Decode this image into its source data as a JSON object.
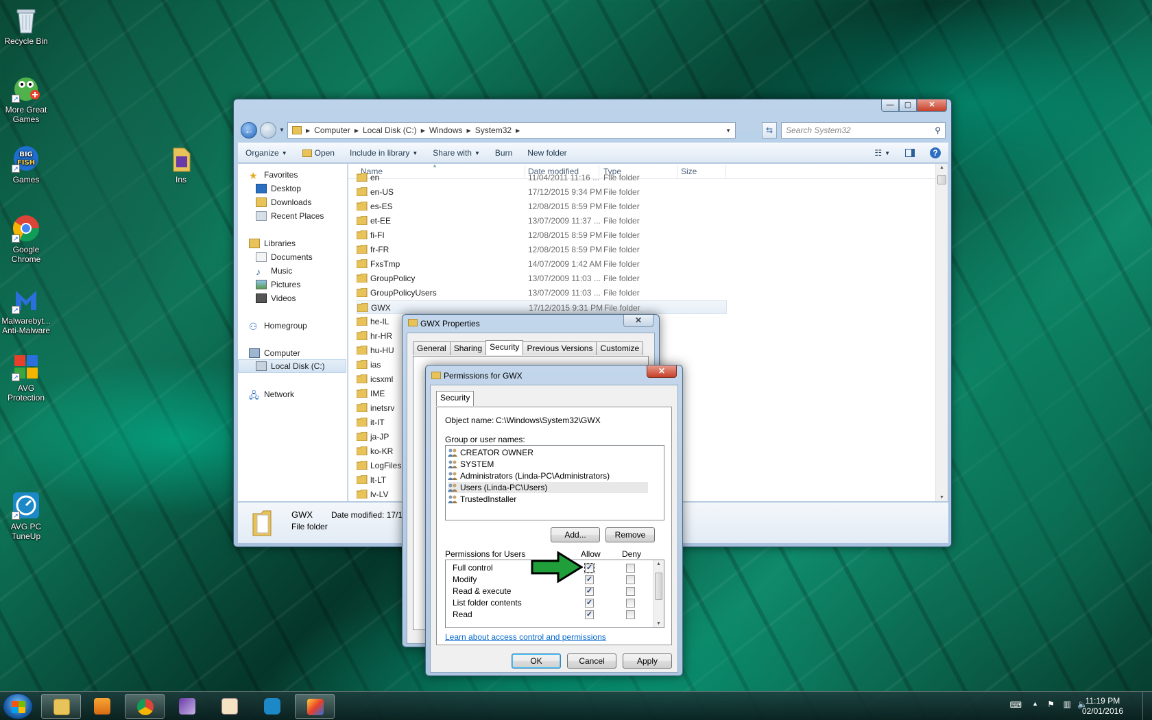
{
  "desktop": {
    "icons": [
      {
        "label": "Recycle Bin"
      },
      {
        "label": "More Great Games"
      },
      {
        "label": "Games"
      },
      {
        "label": "Google Chrome"
      },
      {
        "label": "Malwarebyt... Anti-Malware"
      },
      {
        "label": "AVG Protection"
      },
      {
        "label": "AVG PC TuneUp"
      },
      {
        "label": "Ins"
      }
    ]
  },
  "explorer": {
    "breadcrumb": [
      "Computer",
      "Local Disk (C:)",
      "Windows",
      "System32"
    ],
    "search_placeholder": "Search System32",
    "toolbar": {
      "organize": "Organize",
      "open": "Open",
      "include": "Include in library",
      "share": "Share with",
      "burn": "Burn",
      "new_folder": "New folder"
    },
    "nav": {
      "favorites": "Favorites",
      "desktop": "Desktop",
      "downloads": "Downloads",
      "recent": "Recent Places",
      "libraries": "Libraries",
      "documents": "Documents",
      "music": "Music",
      "pictures": "Pictures",
      "videos": "Videos",
      "homegroup": "Homegroup",
      "computer": "Computer",
      "local_disk": "Local Disk (C:)",
      "network": "Network"
    },
    "columns": {
      "name": "Name",
      "date": "Date modified",
      "type": "Type",
      "size": "Size"
    },
    "rows": [
      {
        "name": "en",
        "date": "11/04/2011 11:16 ...",
        "type": "File folder"
      },
      {
        "name": "en-US",
        "date": "17/12/2015 9:34 PM",
        "type": "File folder"
      },
      {
        "name": "es-ES",
        "date": "12/08/2015 8:59 PM",
        "type": "File folder"
      },
      {
        "name": "et-EE",
        "date": "13/07/2009 11:37 ...",
        "type": "File folder"
      },
      {
        "name": "fi-FI",
        "date": "12/08/2015 8:59 PM",
        "type": "File folder"
      },
      {
        "name": "fr-FR",
        "date": "12/08/2015 8:59 PM",
        "type": "File folder"
      },
      {
        "name": "FxsTmp",
        "date": "14/07/2009 1:42 AM",
        "type": "File folder"
      },
      {
        "name": "GroupPolicy",
        "date": "13/07/2009 11:03 ...",
        "type": "File folder"
      },
      {
        "name": "GroupPolicyUsers",
        "date": "13/07/2009 11:03 ...",
        "type": "File folder"
      },
      {
        "name": "GWX",
        "date": "17/12/2015 9:31 PM",
        "type": "File folder"
      },
      {
        "name": "he-IL",
        "date": "",
        "type": ""
      },
      {
        "name": "hr-HR",
        "date": "",
        "type": ""
      },
      {
        "name": "hu-HU",
        "date": "",
        "type": ""
      },
      {
        "name": "ias",
        "date": "",
        "type": ""
      },
      {
        "name": "icsxml",
        "date": "",
        "type": ""
      },
      {
        "name": "IME",
        "date": "",
        "type": ""
      },
      {
        "name": "inetsrv",
        "date": "",
        "type": ""
      },
      {
        "name": "it-IT",
        "date": "",
        "type": ""
      },
      {
        "name": "ja-JP",
        "date": "",
        "type": ""
      },
      {
        "name": "ko-KR",
        "date": "",
        "type": ""
      },
      {
        "name": "LogFiles",
        "date": "",
        "type": ""
      },
      {
        "name": "lt-LT",
        "date": "",
        "type": ""
      },
      {
        "name": "lv-LV",
        "date": "",
        "type": ""
      }
    ],
    "details": {
      "name": "GWX",
      "type": "File folder",
      "date_label": "Date modified: 17/1"
    }
  },
  "properties": {
    "title": "GWX Properties",
    "tabs": [
      "General",
      "Sharing",
      "Security",
      "Previous Versions",
      "Customize"
    ]
  },
  "permissions": {
    "title": "Permissions for GWX",
    "tab": "Security",
    "object_label": "Object name:",
    "object_value": "C:\\Windows\\System32\\GWX",
    "group_label": "Group or user names:",
    "users": [
      "CREATOR OWNER",
      "SYSTEM",
      "Administrators (Linda-PC\\Administrators)",
      "Users (Linda-PC\\Users)",
      "TrustedInstaller"
    ],
    "add": "Add...",
    "remove": "Remove",
    "perm_label": "Permissions for Users",
    "allow": "Allow",
    "deny": "Deny",
    "perms": [
      {
        "name": "Full control",
        "allow": true,
        "deny": false
      },
      {
        "name": "Modify",
        "allow": true,
        "deny": false
      },
      {
        "name": "Read & execute",
        "allow": true,
        "deny": false
      },
      {
        "name": "List folder contents",
        "allow": true,
        "deny": false
      },
      {
        "name": "Read",
        "allow": true,
        "deny": false
      }
    ],
    "link": "Learn about access control and permissions",
    "ok": "OK",
    "cancel": "Cancel",
    "apply": "Apply"
  },
  "taskbar": {
    "time": "11:19 PM",
    "date": "02/01/2016"
  },
  "colors": {
    "arrow": "#1f9e3a",
    "folder": "#e8c35a",
    "selection": "#e8e8e8"
  }
}
